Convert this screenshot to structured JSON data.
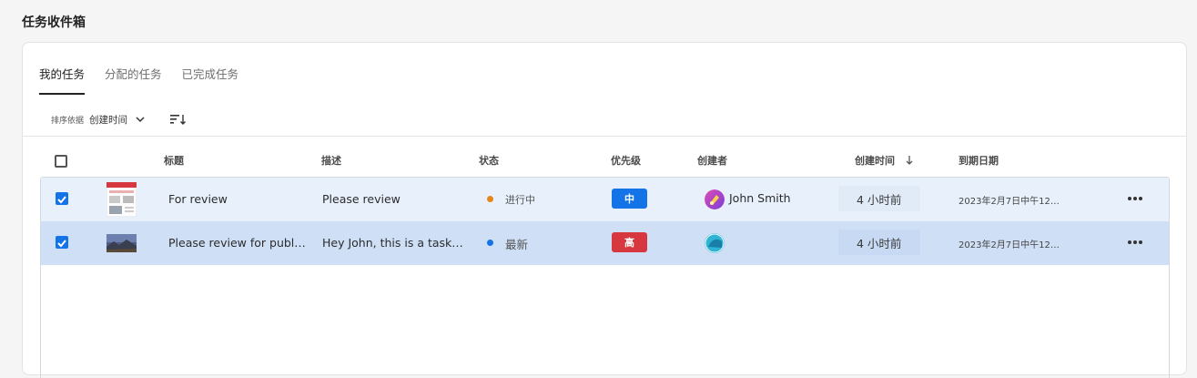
{
  "page": {
    "title": "任务收件箱"
  },
  "tabs": [
    {
      "label": "我的任务",
      "active": true
    },
    {
      "label": "分配的任务",
      "active": false
    },
    {
      "label": "已完成任务",
      "active": false
    }
  ],
  "sort": {
    "prefix": "排序依据",
    "value": "创建时间"
  },
  "table": {
    "columns": [
      "标题",
      "描述",
      "状态",
      "优先级",
      "创建者",
      "创建时间",
      "到期日期"
    ],
    "rows": [
      {
        "title": "For review",
        "description": "Please review",
        "status": "进行中",
        "status_color": "#e68619",
        "priority": "中",
        "priority_color": "#1473e6",
        "creator": "John Smith",
        "created": "4 小时前",
        "due": "2023年2月7日中午12…",
        "checked": true
      },
      {
        "title": "Please review for publ…",
        "description": "Hey John, this is a task…",
        "status": "最新",
        "status_color": "#1473e6",
        "priority": "高",
        "priority_color": "#d7373f",
        "creator": "",
        "created": "4 小时前",
        "due": "2023年2月7日中午12…",
        "checked": true
      }
    ]
  }
}
